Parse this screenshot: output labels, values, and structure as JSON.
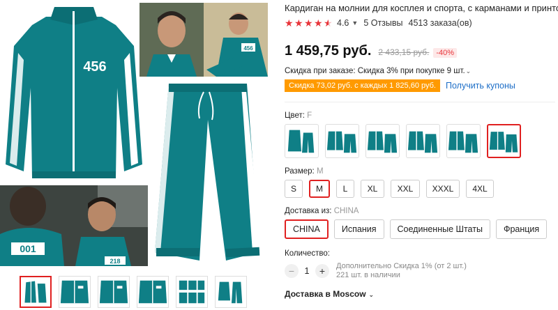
{
  "product": {
    "title": "Кардиган на молнии для косплея и спорта, с карманами и принтом",
    "rating": "4.6",
    "reviews": "5 Отзывы",
    "orders": "4513 заказа(ов)",
    "price": "1 459,75 руб.",
    "old_price": "2 433,15 руб.",
    "discount": "-40%",
    "order_discount": "Скидка при заказе: Скидка 3% при покупке 9 шт.",
    "coupon_badge": "Скидка 73,02 руб. с каждых 1 825,60 руб.",
    "coupon_link": "Получить купоны"
  },
  "images": {
    "jacket_number": "456",
    "still_number_top": "456",
    "still_number_1": "001",
    "still_number_2": "218"
  },
  "color": {
    "label": "Цвет:",
    "value": "F"
  },
  "size": {
    "label": "Размер:",
    "value": "M",
    "options": [
      "S",
      "M",
      "L",
      "XL",
      "XXL",
      "XXXL",
      "4XL"
    ]
  },
  "shipping": {
    "label": "Доставка из:",
    "value": "CHINA",
    "options": [
      "CHINA",
      "Испания",
      "Соединенные Штаты",
      "Франция"
    ]
  },
  "quantity": {
    "label": "Количество:",
    "value": "1",
    "extra_discount": "Дополнительно Скидка 1% (от 2 шт.)",
    "available": "221 шт. в наличии"
  },
  "delivery": {
    "label": "Доставка в Moscow"
  },
  "colors": {
    "accent": "#e02020",
    "teal": "#0f7f86",
    "price_red": "#e8343a",
    "coupon": "#ff9a00",
    "link": "#1d6ec7"
  }
}
